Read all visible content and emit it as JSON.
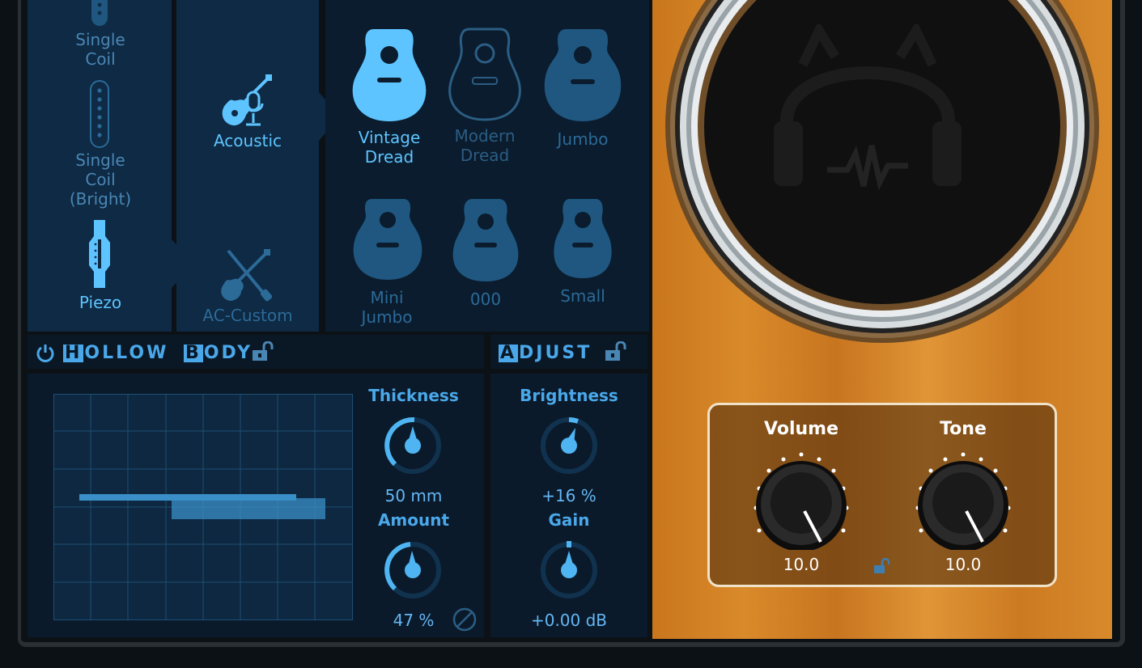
{
  "pickups": {
    "items": [
      {
        "label_line1": "Single",
        "label_line2": "Coil",
        "label_line3": ""
      },
      {
        "label_line1": "Single",
        "label_line2": "Coil",
        "label_line3": "(Bright)"
      },
      {
        "label_line1": "Piezo",
        "label_line2": "",
        "label_line3": ""
      }
    ],
    "selected": "Piezo"
  },
  "instrument_types": {
    "items": [
      "Acoustic",
      "AC-Custom"
    ],
    "selected": "Acoustic"
  },
  "body_types": {
    "items": [
      {
        "line1": "Vintage",
        "line2": "Dread"
      },
      {
        "line1": "Modern",
        "line2": "Dread"
      },
      {
        "line1": "Jumbo",
        "line2": ""
      },
      {
        "line1": "Mini",
        "line2": "Jumbo"
      },
      {
        "line1": "000",
        "line2": ""
      },
      {
        "line1": "Small",
        "line2": ""
      }
    ],
    "selected": "Vintage Dread"
  },
  "hollow_body": {
    "title_letter1": "H",
    "title_rest1": "OLLOW",
    "title_letter2": "B",
    "title_rest2": "ODY",
    "thickness_label": "Thickness",
    "thickness_value": "50 mm",
    "thickness_fraction": 0.55,
    "amount_label": "Amount",
    "amount_value": "47 %",
    "amount_fraction": 0.47
  },
  "adjust": {
    "title_letter": "A",
    "title_rest": "DJUST",
    "brightness_label": "Brightness",
    "brightness_value": "+16 %",
    "brightness_fraction": 0.58,
    "gain_label": "Gain",
    "gain_value": "+0.00 dB",
    "gain_fraction": 0.5
  },
  "amp_controls": {
    "volume_label": "Volume",
    "volume_value": "10.0",
    "tone_label": "Tone",
    "tone_value": "10.0"
  },
  "colors": {
    "accent": "#4aa8ea",
    "selected": "#5ec4ff",
    "wood": "#d3842a"
  }
}
